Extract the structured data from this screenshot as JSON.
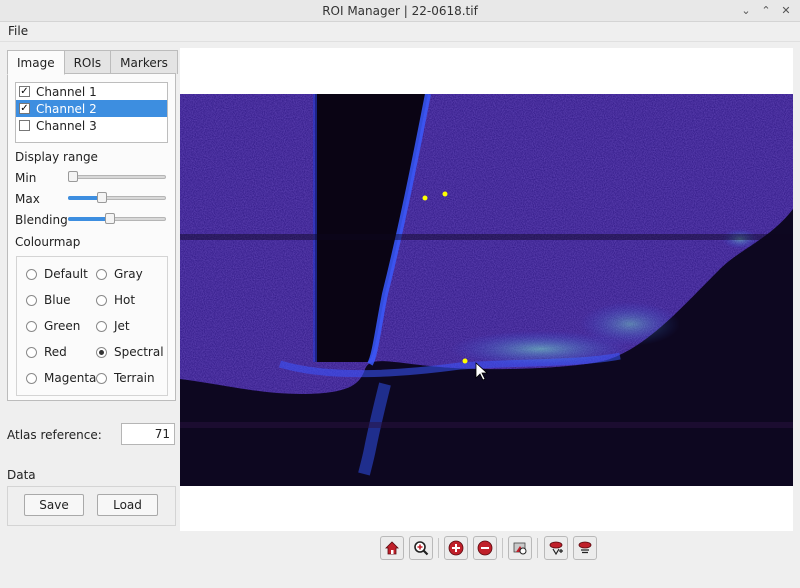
{
  "window": {
    "title": "ROI Manager   |   22-0618.tif",
    "minimize": "⌄",
    "maximize": "⌃",
    "close": "✕"
  },
  "menu": {
    "file": "File"
  },
  "tabs": {
    "image": "Image",
    "rois": "ROIs",
    "markers": "Markers"
  },
  "channels": [
    {
      "label": "Channel 1",
      "checked": "✓"
    },
    {
      "label": "Channel 2",
      "checked": "✓"
    },
    {
      "label": "Channel 3",
      "checked": ""
    }
  ],
  "display_range": {
    "title": "Display range",
    "min_label": "Min",
    "min_value": 0.0,
    "max_label": "Max",
    "max_value": 0.33,
    "blending_label": "Blending",
    "blending_value": 0.42
  },
  "colourmap": {
    "title": "Colourmap",
    "options": [
      "Default",
      "Gray",
      "Blue",
      "Hot",
      "Green",
      "Jet",
      "Red",
      "Spectral",
      "Magenta",
      "Terrain"
    ],
    "selected": "Spectral"
  },
  "atlas": {
    "label": "Atlas reference:",
    "value": "71"
  },
  "data": {
    "title": "Data",
    "save": "Save",
    "load": "Load"
  },
  "toolbar": {
    "icons": [
      "home-icon",
      "zoom-region-icon",
      "zoom-in-icon",
      "zoom-out-icon",
      "reset-view-icon",
      "add-marker-icon",
      "remove-marker-icon"
    ]
  },
  "colors": {
    "accent": "#3d8ee0",
    "image_bg": "#0d0720",
    "tissue": "#3b1f9a",
    "marker": "#ffff00",
    "icon_red": "#c0202a"
  }
}
